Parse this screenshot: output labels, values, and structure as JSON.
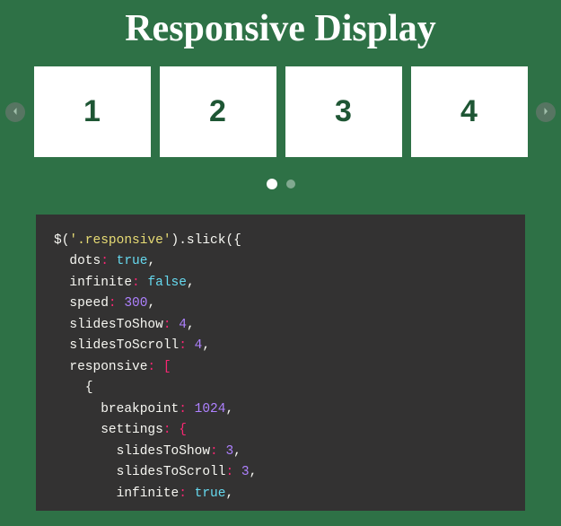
{
  "heading": "Responsive Display",
  "slides": [
    "1",
    "2",
    "3",
    "4"
  ],
  "code": {
    "l1a": "$(",
    "l1b": "'.responsive'",
    "l1c": ").slick({",
    "l2a": "dots",
    "l2b": ":",
    "l2c": "true",
    "l2d": ",",
    "l3a": "infinite",
    "l3b": ":",
    "l3c": "false",
    "l3d": ",",
    "l4a": "speed",
    "l4b": ":",
    "l4c": "300",
    "l4d": ",",
    "l5a": "slidesToShow",
    "l5b": ":",
    "l5c": "4",
    "l5d": ",",
    "l6a": "slidesToScroll",
    "l6b": ":",
    "l6c": "4",
    "l6d": ",",
    "l7a": "responsive",
    "l7b": ": [",
    "l8": "{",
    "l9a": "breakpoint",
    "l9b": ":",
    "l9c": "1024",
    "l9d": ",",
    "l10a": "settings",
    "l10b": ": {",
    "l11a": "slidesToShow",
    "l11b": ":",
    "l11c": "3",
    "l11d": ",",
    "l12a": "slidesToScroll",
    "l12b": ":",
    "l12c": "3",
    "l12d": ",",
    "l13a": "infinite",
    "l13b": ":",
    "l13c": "true",
    "l13d": ","
  }
}
